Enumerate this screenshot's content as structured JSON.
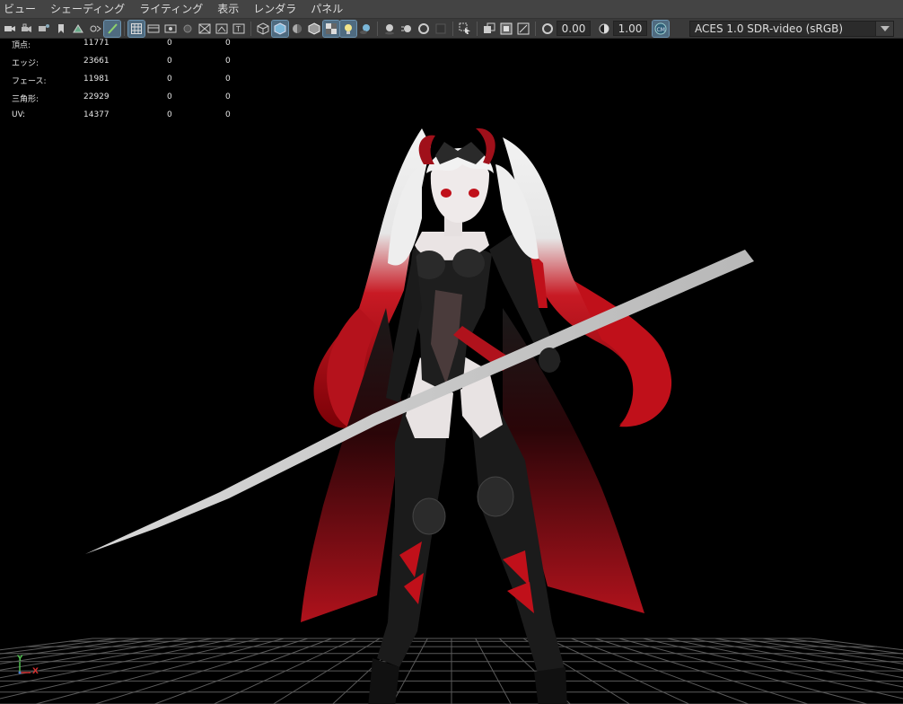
{
  "menu": {
    "items": [
      "ビュー",
      "シェーディング",
      "ライティング",
      "表示",
      "レンダラ",
      "パネル"
    ]
  },
  "toolbar": {
    "exposure_value": "0.00",
    "gamma_value": "1.00",
    "colorspace_label": "ACES 1.0 SDR-video (sRGB)",
    "icons": [
      "camera-icon",
      "camera-lock-icon",
      "camera-attr-icon",
      "bookmark-icon",
      "image-plane-icon",
      "two-d-pan-icon",
      "grease-pencil-icon",
      "grid-icon",
      "film-gate-icon",
      "resolution-gate-icon",
      "gate-mask-icon",
      "field-chart-icon",
      "safe-action-icon",
      "safe-title-icon",
      "wireframe-icon",
      "smooth-shade-icon",
      "default-material-icon",
      "wireframe-on-shaded-icon",
      "textured-icon",
      "lights-icon",
      "shadows-icon",
      "ambient-occlusion-icon",
      "motion-blur-icon",
      "anti-alias-icon",
      "depth-of-field-icon",
      "isolate-select-icon",
      "xray-icon",
      "xray-joints-icon",
      "xray-active-icon",
      "exposure-icon",
      "gamma-icon",
      "color-management-icon"
    ]
  },
  "heads_up": {
    "rows": [
      {
        "label": "頂点:",
        "values": [
          "11771",
          "0",
          "0"
        ]
      },
      {
        "label": "エッジ:",
        "values": [
          "23661",
          "0",
          "0"
        ]
      },
      {
        "label": "フェース:",
        "values": [
          "11981",
          "0",
          "0"
        ]
      },
      {
        "label": "三角形:",
        "values": [
          "22929",
          "0",
          "0"
        ]
      },
      {
        "label": "UV:",
        "values": [
          "14377",
          "0",
          "0"
        ]
      }
    ]
  },
  "axis_gizmo": {
    "y": "Y",
    "x": "X"
  },
  "colors": {
    "menubar_bg": "#444444",
    "toolbar_bg": "#3a3a3a",
    "viewport_bg": "#000000",
    "grid_line": "#5a5a5a",
    "accent_red": "#c0101a",
    "active_button": "#4f6b80"
  }
}
